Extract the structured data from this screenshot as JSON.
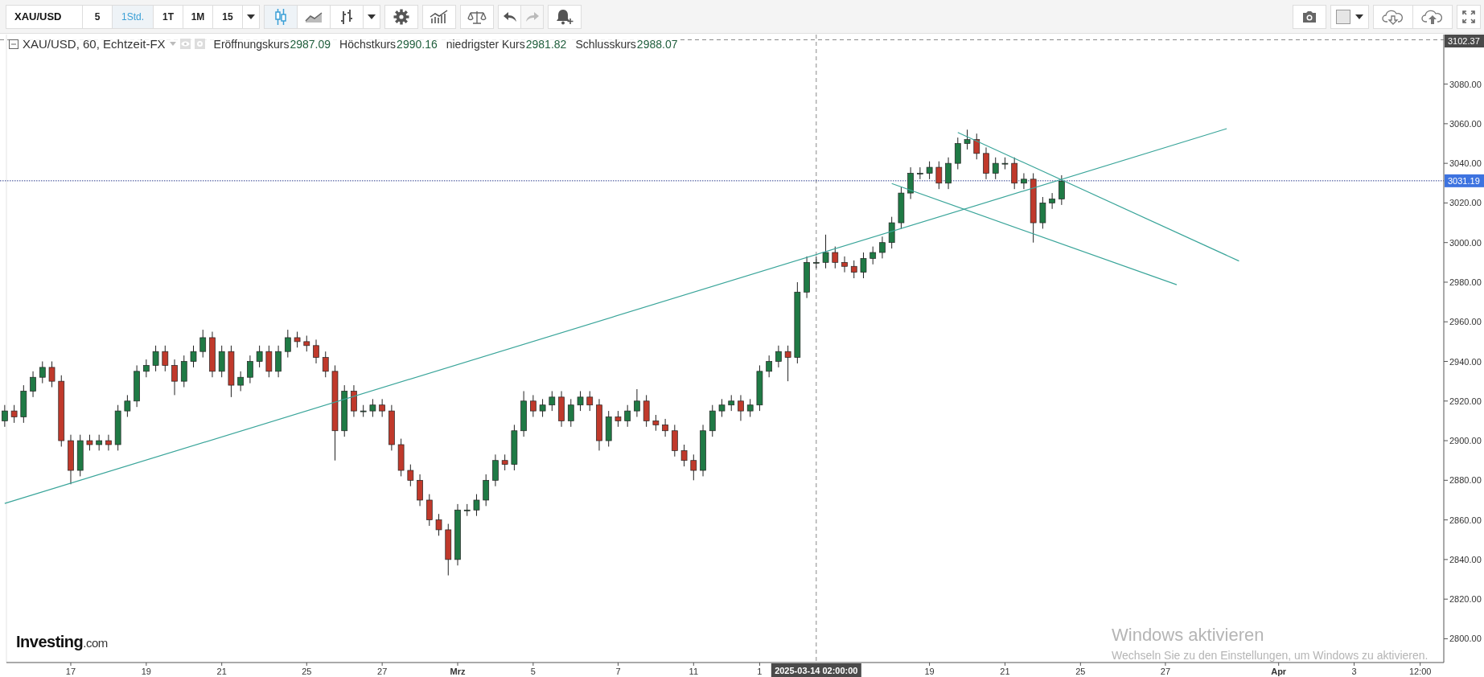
{
  "toolbar": {
    "symbol_field": {
      "value": "XAU/USD"
    },
    "intervals": [
      {
        "label": "5",
        "selected": false
      },
      {
        "label": "1Std.",
        "selected": true
      },
      {
        "label": "1T",
        "selected": false
      },
      {
        "label": "1M",
        "selected": false
      },
      {
        "label": "15",
        "selected": false
      }
    ],
    "chart_styles": [
      {
        "kind": "candles",
        "selected": true
      },
      {
        "kind": "line",
        "selected": false
      },
      {
        "kind": "bars",
        "selected": false
      }
    ],
    "redo_disabled": true
  },
  "legend": {
    "title": "XAU/USD, 60, Echtzeit-FX",
    "fields": [
      {
        "label": "Eröffnungskurs",
        "value": "2987.09"
      },
      {
        "label": "Höchstkurs",
        "value": "2990.16"
      },
      {
        "label": "niedrigster Kurs",
        "value": "2981.82"
      },
      {
        "label": "Schlusskurs",
        "value": "2988.07"
      }
    ]
  },
  "chart_data": {
    "type": "candlestick",
    "ylim": [
      2788,
      3105
    ],
    "yticks": [
      {
        "value": 2800,
        "label": "2800.00"
      },
      {
        "value": 2820,
        "label": "2820.00"
      },
      {
        "value": 2840,
        "label": "2840.00"
      },
      {
        "value": 2860,
        "label": "2860.00"
      },
      {
        "value": 2880,
        "label": "2880.00"
      },
      {
        "value": 2900,
        "label": "2900.00"
      },
      {
        "value": 2920,
        "label": "2920.00"
      },
      {
        "value": 2940,
        "label": "2940.00"
      },
      {
        "value": 2960,
        "label": "2960.00"
      },
      {
        "value": 2980,
        "label": "2980.00"
      },
      {
        "value": 3000,
        "label": "3000.00"
      },
      {
        "value": 3020,
        "label": "3020.00"
      },
      {
        "value": 3040,
        "label": "3040.00"
      },
      {
        "value": 3060,
        "label": "3060.00"
      },
      {
        "value": 3080,
        "label": "3080.00"
      }
    ],
    "categories": [
      null,
      null,
      null,
      null,
      null,
      null,
      null,
      "17",
      null,
      null,
      null,
      null,
      null,
      null,
      null,
      "19",
      null,
      null,
      null,
      null,
      null,
      null,
      null,
      "21",
      null,
      null,
      null,
      null,
      null,
      null,
      null,
      null,
      "25",
      null,
      null,
      null,
      null,
      null,
      null,
      null,
      "27",
      null,
      null,
      null,
      null,
      null,
      null,
      null,
      "Mrz",
      null,
      null,
      null,
      null,
      null,
      null,
      null,
      "5",
      null,
      null,
      null,
      null,
      null,
      null,
      null,
      null,
      "7",
      null,
      null,
      null,
      null,
      null,
      null,
      null,
      "11",
      null,
      null,
      null,
      null,
      null,
      null,
      "1",
      null,
      null,
      null,
      null,
      null,
      "2025-03-14 02:00:00",
      null,
      null,
      null,
      null,
      null,
      null,
      null,
      null,
      null,
      null,
      null,
      "19",
      null,
      null,
      null,
      null,
      null,
      null,
      null,
      "21",
      null,
      null,
      null,
      null,
      null,
      null,
      null,
      "25",
      null,
      null,
      null,
      null,
      null,
      null,
      null,
      null,
      "27",
      null,
      null,
      null,
      null,
      null,
      null,
      null,
      null,
      null,
      null,
      null,
      "Apr",
      null,
      null,
      null,
      null,
      null,
      null,
      null,
      "3",
      null,
      null,
      null,
      null,
      null,
      null,
      "12:00",
      null,
      null
    ],
    "ohlc": [
      [
        2910,
        2918,
        2907,
        2915
      ],
      [
        2915,
        2918,
        2909,
        2912
      ],
      [
        2912,
        2928,
        2909,
        2925
      ],
      [
        2925,
        2935,
        2922,
        2932
      ],
      [
        2932,
        2940,
        2929,
        2937
      ],
      [
        2937,
        2940,
        2927,
        2930
      ],
      [
        2930,
        2933,
        2897,
        2900
      ],
      [
        2900,
        2903,
        2878,
        2885
      ],
      [
        2885,
        2903,
        2882,
        2900
      ],
      [
        2900,
        2903,
        2895,
        2898
      ],
      [
        2898,
        2903,
        2895,
        2900
      ],
      [
        2900,
        2903,
        2895,
        2898
      ],
      [
        2898,
        2918,
        2895,
        2915
      ],
      [
        2915,
        2923,
        2912,
        2920
      ],
      [
        2920,
        2938,
        2917,
        2935
      ],
      [
        2935,
        2941,
        2932,
        2938
      ],
      [
        2938,
        2948,
        2935,
        2945
      ],
      [
        2945,
        2948,
        2935,
        2938
      ],
      [
        2938,
        2941,
        2923,
        2930
      ],
      [
        2930,
        2943,
        2927,
        2940
      ],
      [
        2940,
        2948,
        2937,
        2945
      ],
      [
        2945,
        2956,
        2942,
        2952
      ],
      [
        2952,
        2955,
        2932,
        2935
      ],
      [
        2935,
        2948,
        2932,
        2945
      ],
      [
        2945,
        2948,
        2922,
        2928
      ],
      [
        2928,
        2935,
        2925,
        2932
      ],
      [
        2932,
        2943,
        2929,
        2940
      ],
      [
        2940,
        2948,
        2937,
        2945
      ],
      [
        2945,
        2948,
        2932,
        2935
      ],
      [
        2935,
        2948,
        2932,
        2945
      ],
      [
        2945,
        2956,
        2942,
        2952
      ],
      [
        2952,
        2955,
        2947,
        2950
      ],
      [
        2950,
        2953,
        2945,
        2948
      ],
      [
        2948,
        2951,
        2939,
        2942
      ],
      [
        2942,
        2945,
        2932,
        2935
      ],
      [
        2935,
        2938,
        2890,
        2905
      ],
      [
        2905,
        2928,
        2902,
        2925
      ],
      [
        2925,
        2928,
        2912,
        2915
      ],
      [
        2915,
        2918,
        2912,
        2915
      ],
      [
        2915,
        2921,
        2912,
        2918
      ],
      [
        2918,
        2921,
        2912,
        2915
      ],
      [
        2915,
        2918,
        2895,
        2898
      ],
      [
        2898,
        2901,
        2882,
        2885
      ],
      [
        2885,
        2888,
        2877,
        2880
      ],
      [
        2880,
        2883,
        2867,
        2870
      ],
      [
        2870,
        2873,
        2857,
        2860
      ],
      [
        2860,
        2863,
        2852,
        2855
      ],
      [
        2855,
        2858,
        2832,
        2840
      ],
      [
        2840,
        2868,
        2837,
        2865
      ],
      [
        2865,
        2868,
        2862,
        2865
      ],
      [
        2865,
        2873,
        2862,
        2870
      ],
      [
        2870,
        2883,
        2867,
        2880
      ],
      [
        2880,
        2893,
        2877,
        2890
      ],
      [
        2890,
        2893,
        2885,
        2888
      ],
      [
        2888,
        2908,
        2885,
        2905
      ],
      [
        2905,
        2925,
        2902,
        2920
      ],
      [
        2920,
        2923,
        2912,
        2915
      ],
      [
        2915,
        2921,
        2912,
        2918
      ],
      [
        2918,
        2925,
        2915,
        2922
      ],
      [
        2922,
        2925,
        2907,
        2910
      ],
      [
        2910,
        2921,
        2907,
        2918
      ],
      [
        2918,
        2925,
        2915,
        2922
      ],
      [
        2922,
        2925,
        2915,
        2918
      ],
      [
        2918,
        2921,
        2895,
        2900
      ],
      [
        2900,
        2915,
        2897,
        2912
      ],
      [
        2912,
        2915,
        2907,
        2910
      ],
      [
        2910,
        2918,
        2907,
        2915
      ],
      [
        2915,
        2926,
        2912,
        2920
      ],
      [
        2920,
        2923,
        2907,
        2910
      ],
      [
        2910,
        2913,
        2905,
        2908
      ],
      [
        2908,
        2911,
        2902,
        2905
      ],
      [
        2905,
        2908,
        2892,
        2895
      ],
      [
        2895,
        2898,
        2887,
        2890
      ],
      [
        2890,
        2893,
        2880,
        2885
      ],
      [
        2885,
        2908,
        2882,
        2905
      ],
      [
        2905,
        2918,
        2902,
        2915
      ],
      [
        2915,
        2921,
        2912,
        2918
      ],
      [
        2918,
        2923,
        2915,
        2920
      ],
      [
        2920,
        2923,
        2910,
        2915
      ],
      [
        2915,
        2921,
        2912,
        2918
      ],
      [
        2918,
        2938,
        2915,
        2935
      ],
      [
        2935,
        2943,
        2932,
        2940
      ],
      [
        2940,
        2948,
        2937,
        2945
      ],
      [
        2945,
        2948,
        2930,
        2942
      ],
      [
        2942,
        2980,
        2939,
        2975
      ],
      [
        2975,
        2993,
        2972,
        2990
      ],
      [
        2990,
        2993,
        2987,
        2990
      ],
      [
        2990,
        3004,
        2987,
        2995
      ],
      [
        2995,
        2998,
        2987,
        2990
      ],
      [
        2990,
        2993,
        2985,
        2988
      ],
      [
        2988,
        2991,
        2982,
        2985
      ],
      [
        2985,
        2995,
        2982,
        2992
      ],
      [
        2992,
        2998,
        2989,
        2995
      ],
      [
        2995,
        3003,
        2992,
        3000
      ],
      [
        3000,
        3013,
        2997,
        3010
      ],
      [
        3010,
        3028,
        3007,
        3025
      ],
      [
        3025,
        3038,
        3022,
        3035
      ],
      [
        3035,
        3038,
        3032,
        3035
      ],
      [
        3035,
        3041,
        3032,
        3038
      ],
      [
        3038,
        3041,
        3027,
        3030
      ],
      [
        3030,
        3043,
        3027,
        3040
      ],
      [
        3040,
        3053,
        3037,
        3050
      ],
      [
        3050,
        3057,
        3047,
        3052
      ],
      [
        3052,
        3055,
        3042,
        3045
      ],
      [
        3045,
        3048,
        3032,
        3035
      ],
      [
        3035,
        3043,
        3032,
        3040
      ],
      [
        3040,
        3043,
        3037,
        3040
      ],
      [
        3040,
        3043,
        3027,
        3030
      ],
      [
        3030,
        3035,
        3027,
        3032
      ],
      [
        3032,
        3035,
        3000,
        3010
      ],
      [
        3010,
        3023,
        3007,
        3020
      ],
      [
        3020,
        3025,
        3017,
        3022
      ],
      [
        3022,
        3034,
        3019,
        3031
      ],
      null,
      null,
      null,
      null,
      null,
      null,
      null,
      null,
      null,
      null,
      null,
      null,
      null,
      null,
      null,
      null,
      null,
      null,
      null,
      null,
      null,
      null,
      null,
      null,
      null,
      null,
      null,
      null,
      null,
      null,
      null,
      null,
      null,
      null,
      null,
      null,
      null,
      null,
      null,
      null
    ],
    "ref_lines": [
      {
        "axis": "y",
        "value": 3031.19,
        "label": "3031.19"
      },
      {
        "axis": "y",
        "value": 3102.37,
        "label": "3102.37"
      }
    ]
  },
  "logo": {
    "name": "Investing",
    "suffix": ".com"
  },
  "os_notice": {
    "title": "Windows aktivieren",
    "text": "Wechseln Sie zu den Einstellungen, um Windows zu aktivieren."
  }
}
